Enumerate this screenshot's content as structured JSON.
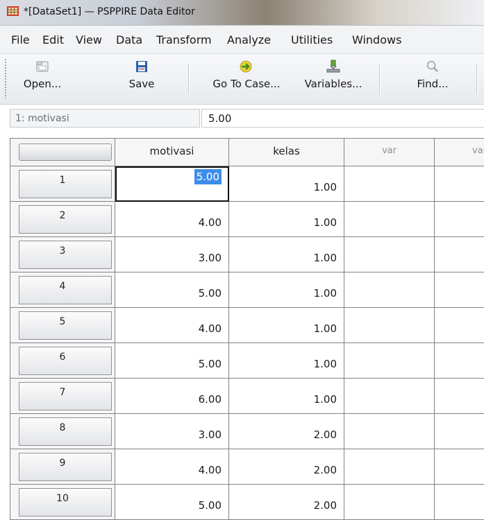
{
  "window": {
    "title": "*[DataSet1] — PSPPIRE Data Editor",
    "accent": "#3d8ee8"
  },
  "menu": [
    "File",
    "Edit",
    "View",
    "Data",
    "Transform",
    "Analyze",
    "Utilities",
    "Windows"
  ],
  "toolbar": [
    {
      "label": "Open...",
      "icon": "folder-open-icon"
    },
    {
      "label": "Save",
      "icon": "floppy-save-icon"
    },
    {
      "label": "Go To Case...",
      "icon": "goto-case-arrow-icon"
    },
    {
      "label": "Variables...",
      "icon": "variables-icon"
    },
    {
      "label": "Find...",
      "icon": "find-magnifier-icon"
    }
  ],
  "reference": {
    "cell": "1: motivasi",
    "value": "5.00"
  },
  "grid": {
    "columns": [
      "motivasi",
      "kelas",
      "var",
      "var"
    ],
    "rows": [
      {
        "id": "1",
        "motivasi": "5.00",
        "kelas": "1.00"
      },
      {
        "id": "2",
        "motivasi": "4.00",
        "kelas": "1.00"
      },
      {
        "id": "3",
        "motivasi": "3.00",
        "kelas": "1.00"
      },
      {
        "id": "4",
        "motivasi": "5.00",
        "kelas": "1.00"
      },
      {
        "id": "5",
        "motivasi": "4.00",
        "kelas": "1.00"
      },
      {
        "id": "6",
        "motivasi": "5.00",
        "kelas": "1.00"
      },
      {
        "id": "7",
        "motivasi": "6.00",
        "kelas": "1.00"
      },
      {
        "id": "8",
        "motivasi": "3.00",
        "kelas": "2.00"
      },
      {
        "id": "9",
        "motivasi": "4.00",
        "kelas": "2.00"
      },
      {
        "id": "10",
        "motivasi": "5.00",
        "kelas": "2.00"
      }
    ],
    "active_cell": {
      "row": "1",
      "column": "motivasi"
    }
  }
}
